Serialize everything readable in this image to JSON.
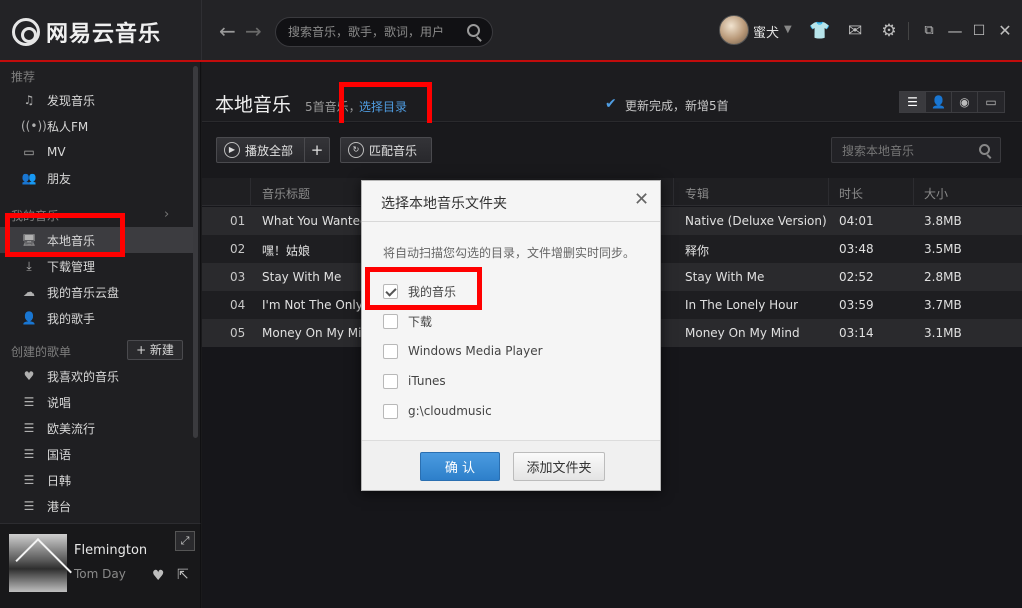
{
  "app": {
    "name": "网易云音乐"
  },
  "search": {
    "placeholder": "搜索音乐，歌手，歌词，用户"
  },
  "user": {
    "name": "蜜犬"
  },
  "sidebar": {
    "recommend_title": "推荐",
    "recommend_items": [
      {
        "label": "发现音乐",
        "icon": "music-note-icon"
      },
      {
        "label": "私人FM",
        "icon": "radio-icon"
      },
      {
        "label": "MV",
        "icon": "tv-icon"
      },
      {
        "label": "朋友",
        "icon": "friends-icon"
      }
    ],
    "my_music_title": "我的音乐",
    "my_music_items": [
      {
        "label": "本地音乐",
        "icon": "monitor-icon",
        "active": true
      },
      {
        "label": "下载管理",
        "icon": "download-icon"
      },
      {
        "label": "我的音乐云盘",
        "icon": "cloud-icon"
      },
      {
        "label": "我的歌手",
        "icon": "person-icon"
      }
    ],
    "created_title": "创建的歌单",
    "new_button": "+ 新建",
    "playlists": [
      {
        "label": "我喜欢的音乐",
        "icon": "heart-icon"
      },
      {
        "label": "说唱",
        "icon": "playlist-icon"
      },
      {
        "label": "欧美流行",
        "icon": "playlist-icon"
      },
      {
        "label": "国语",
        "icon": "playlist-icon"
      },
      {
        "label": "日韩",
        "icon": "playlist-icon"
      },
      {
        "label": "港台",
        "icon": "playlist-icon"
      }
    ]
  },
  "now_playing": {
    "title": "Flemington",
    "artist": "Tom Day"
  },
  "main": {
    "title": "本地音乐",
    "count": "5首音乐，",
    "choose_dir": "选择目录",
    "status": "更新完成，新增5首",
    "play_all": "播放全部",
    "add_label": "+",
    "match": "匹配音乐",
    "local_search_placeholder": "搜索本地音乐",
    "columns": {
      "title": "音乐标题",
      "album": "专辑",
      "duration": "时长",
      "size": "大小"
    },
    "rows": [
      {
        "index": "01",
        "title": "What You Wanted",
        "album": "Native (Deluxe Version)",
        "duration": "04:01",
        "size": "3.8MB"
      },
      {
        "index": "02",
        "title": "嘿！姑娘",
        "album": "释你",
        "duration": "03:48",
        "size": "3.5MB"
      },
      {
        "index": "03",
        "title": "Stay With Me",
        "album": "Stay With Me",
        "duration": "02:52",
        "size": "2.8MB"
      },
      {
        "index": "04",
        "title": "I'm Not The Only One",
        "album": "In The Lonely Hour",
        "duration": "03:59",
        "size": "3.7MB"
      },
      {
        "index": "05",
        "title": "Money On My Mind",
        "album": "Money On My Mind",
        "duration": "03:14",
        "size": "3.1MB"
      }
    ]
  },
  "dialog": {
    "title": "选择本地音乐文件夹",
    "description": "将自动扫描您勾选的目录，文件增删实时同步。",
    "folders": [
      {
        "label": "我的音乐",
        "checked": true
      },
      {
        "label": "下载",
        "checked": false
      },
      {
        "label": "Windows Media Player",
        "checked": false
      },
      {
        "label": "iTunes",
        "checked": false
      },
      {
        "label": "g:\\cloudmusic",
        "checked": false
      }
    ],
    "ok": "确 认",
    "add_folder": "添加文件夹"
  },
  "colors": {
    "accent_red": "#c20c0c",
    "link_blue": "#4f9de2",
    "highlight_box": "#ff0000"
  }
}
